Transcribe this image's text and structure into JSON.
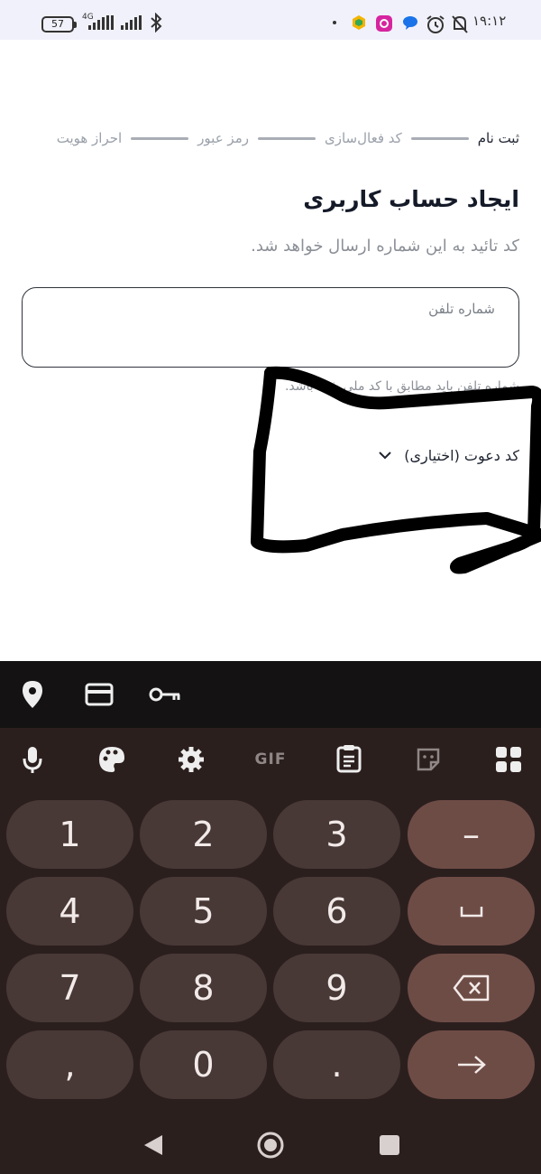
{
  "status_bar": {
    "battery": "57",
    "network": "4G",
    "time": "۱۹:۱۲"
  },
  "stepper": {
    "steps": [
      "ثبت نام",
      "کد فعال‌سازی",
      "رمز عبور",
      "احراز هویت"
    ],
    "active_index": 0
  },
  "form": {
    "title": "ایجاد حساب کاربری",
    "subtitle": "کد تائید به این شماره ارسال خواهد شد.",
    "phone_label": "شماره تلفن",
    "phone_value": "",
    "helper_text": "شماره تلفن باید مطابق با کد ملی شما باشد.",
    "invite_label": "کد دعوت (اختیاری)"
  },
  "keyboard": {
    "suggest_icons": [
      "location-pin-icon",
      "credit-card-icon",
      "key-icon"
    ],
    "toolbar": [
      "mic-icon",
      "palette-icon",
      "settings-icon",
      "GIF",
      "clipboard-icon",
      "sticker-icon",
      "apps-grid-icon"
    ],
    "keys": [
      "1",
      "2",
      "3",
      "–",
      "4",
      "5",
      "6",
      "␣",
      "7",
      "8",
      "9",
      "⌫",
      ",",
      "0",
      ".",
      "→"
    ],
    "colors": {
      "background": "#2b1f1e",
      "key": "#483936",
      "action_key": "#6e4c46",
      "suggest_bar": "#141212"
    }
  },
  "navbar": {
    "buttons": [
      "back-icon",
      "home-icon",
      "recents-icon"
    ]
  }
}
